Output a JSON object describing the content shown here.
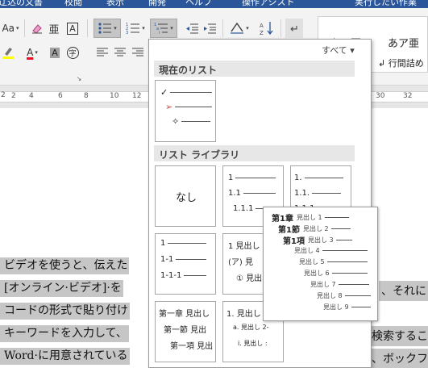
{
  "titlebar": {
    "items": [
      "辽込の文書",
      "校閲",
      "表示",
      "開発",
      "ヘルプ",
      "操作アシスト",
      "実行したい作業"
    ]
  },
  "ribbon": {
    "font_size_button": "Aa",
    "phonetic_guide": "亜",
    "char_border": "A",
    "font_color": "A",
    "char_shading": "A",
    "enclose_char": "字",
    "styles": [
      {
        "sample": "あア亜",
        "name": ""
      },
      {
        "sample": "あア亜",
        "name": "↲ 行間詰め"
      }
    ]
  },
  "ruler": {
    "marker": "2",
    "numbers": [
      "2",
      "4",
      "6",
      "8",
      "10",
      "12",
      "30",
      "32"
    ]
  },
  "panel": {
    "all_label": "すべて ▾",
    "current_list_header": "現在のリスト",
    "library_header": "リスト ライブラリ",
    "current_list_tile": {
      "bullets": [
        "✓",
        "➢",
        "✧"
      ]
    },
    "none_label": "なし",
    "tiles": [
      {
        "rows": [
          "1",
          "1.1",
          "1.1.1"
        ]
      },
      {
        "rows": [
          "1.",
          "1.1.",
          "1.1.1."
        ]
      },
      {
        "rows": [
          "1",
          "1-1",
          "1-1-1"
        ]
      },
      {
        "rows": [
          "1 見出し",
          "(ア) 見",
          "① 見出"
        ]
      },
      {
        "rows": [
          "第一章 見出し",
          "第一節 見出",
          "第一項 見出"
        ]
      },
      {
        "rows": [
          "1. 見出し",
          "a. 見出し 2-",
          "i. 見出し :"
        ]
      }
    ]
  },
  "preview": {
    "rows": [
      {
        "label": "第1章",
        "tag": "見出し 1"
      },
      {
        "label": "第1節",
        "tag": "見出し 2"
      },
      {
        "label": "第1項",
        "tag": "見出し 3"
      },
      {
        "label": "",
        "tag": "見出し 4"
      },
      {
        "label": "",
        "tag": "見出し 5"
      },
      {
        "label": "",
        "tag": "見出し 6"
      },
      {
        "label": "",
        "tag": "見出し 7"
      },
      {
        "label": "",
        "tag": "見出し 8"
      },
      {
        "label": "",
        "tag": "見出し 9"
      }
    ]
  },
  "document": {
    "lines": [
      {
        "left": "ビデオを使うと、伝えた",
        "right": ""
      },
      {
        "left": "[オンライン·ビデオ]·を",
        "right": "、それに"
      },
      {
        "left": "コードの形式で貼り付け",
        "right": ""
      },
      {
        "left": "キーワードを入力して、",
        "right": "検索するこ"
      },
      {
        "left": "Word·に用意されている",
        "right": "、ボックフ"
      }
    ]
  }
}
